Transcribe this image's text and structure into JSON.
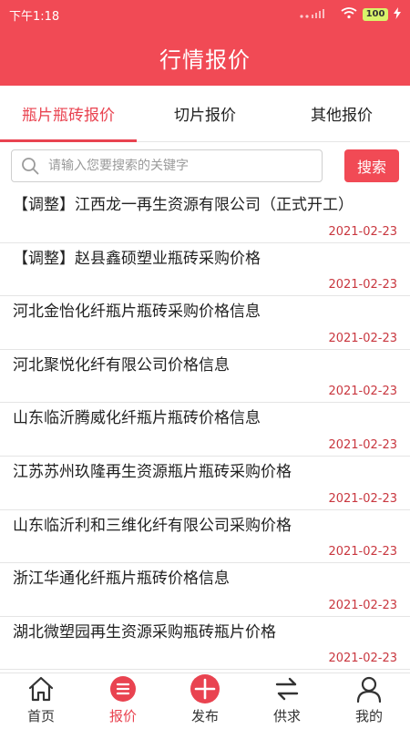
{
  "status_bar": {
    "time": "下午1:18",
    "battery": "100"
  },
  "header": {
    "title": "行情报价"
  },
  "tabs": [
    {
      "label": "瓶片瓶砖报价",
      "active": true
    },
    {
      "label": "切片报价",
      "active": false
    },
    {
      "label": "其他报价",
      "active": false
    }
  ],
  "search": {
    "placeholder": "请输入您要搜索的关键字",
    "value": "",
    "button_label": "搜索"
  },
  "news": [
    {
      "title": "【调整】江西龙一再生资源有限公司（正式开工）",
      "date": "2021-02-23"
    },
    {
      "title": "【调整】赵县鑫硕塑业瓶砖采购价格",
      "date": "2021-02-23"
    },
    {
      "title": "河北金怡化纤瓶片瓶砖采购价格信息",
      "date": "2021-02-23"
    },
    {
      "title": "河北聚悦化纤有限公司价格信息",
      "date": "2021-02-23"
    },
    {
      "title": "山东临沂腾威化纤瓶片瓶砖价格信息",
      "date": "2021-02-23"
    },
    {
      "title": "江苏苏州玖隆再生资源瓶片瓶砖采购价格",
      "date": "2021-02-23"
    },
    {
      "title": "山东临沂利和三维化纤有限公司采购价格",
      "date": "2021-02-23"
    },
    {
      "title": "浙江华通化纤瓶片瓶砖价格信息",
      "date": "2021-02-23"
    },
    {
      "title": "湖北微塑园再生资源采购瓶砖瓶片价格",
      "date": "2021-02-23"
    }
  ],
  "bottom_nav": [
    {
      "label": "首页",
      "icon": "home-icon"
    },
    {
      "label": "报价",
      "icon": "list-icon"
    },
    {
      "label": "发布",
      "icon": "plus-icon"
    },
    {
      "label": "供求",
      "icon": "swap-icon"
    },
    {
      "label": "我的",
      "icon": "user-icon"
    }
  ],
  "colors": {
    "primary": "#f14a55",
    "date": "#c9373f",
    "active_tab": "#e94350"
  }
}
